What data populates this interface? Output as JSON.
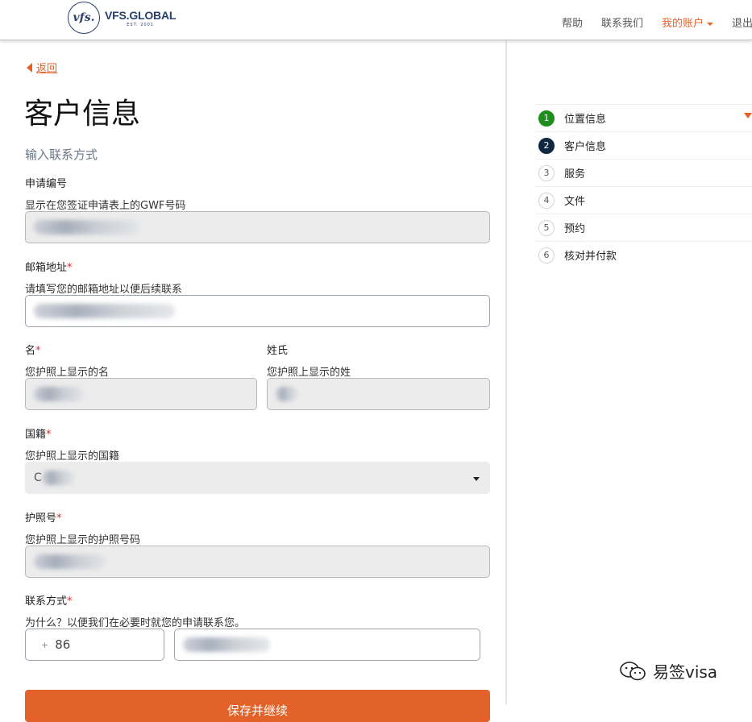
{
  "header": {
    "logo": {
      "mark": "vfs.",
      "name": "VFS.GLOBAL",
      "est": "EST. 2001"
    },
    "nav": {
      "help": "帮助",
      "contact": "联系我们",
      "account": "我的账户",
      "logout": "退出"
    }
  },
  "back_link": "返回",
  "page_title": "客户信息",
  "subtitle": "输入联系方式",
  "fields": {
    "app_number": {
      "label": "申请编号",
      "hint": "显示在您签证申请表上的GWF号码"
    },
    "email": {
      "label": "邮箱地址",
      "required": "*",
      "hint": "请填写您的邮箱地址以便后续联系"
    },
    "first_name": {
      "label": "名",
      "required": "*",
      "hint": "您护照上显示的名"
    },
    "last_name": {
      "label": "姓氏",
      "hint": "您护照上显示的姓"
    },
    "nationality": {
      "label": "国籍",
      "required": "*",
      "hint": "您护照上显示的国籍",
      "value_prefix": "C"
    },
    "passport": {
      "label": "护照号",
      "required": "*",
      "hint": "您护照上显示的护照号码"
    },
    "contact": {
      "label": "联系方式",
      "required": "*",
      "hint": "为什么？以便我们在必要时就您的申请联系您。",
      "plus": "+",
      "country_code": "86"
    }
  },
  "submit_label": "保存并继续",
  "steps": [
    {
      "num": "1",
      "label": "位置信息",
      "state": "done"
    },
    {
      "num": "2",
      "label": "客户信息",
      "state": "current"
    },
    {
      "num": "3",
      "label": "服务",
      "state": "todo"
    },
    {
      "num": "4",
      "label": "文件",
      "state": "todo"
    },
    {
      "num": "5",
      "label": "预约",
      "state": "todo"
    },
    {
      "num": "6",
      "label": "核对并付款",
      "state": "todo"
    }
  ],
  "watermark": "易签visa",
  "colors": {
    "accent": "#e2622a",
    "step_done": "#1e8e1e",
    "step_current": "#0f2840",
    "required": "#d32f2f"
  }
}
